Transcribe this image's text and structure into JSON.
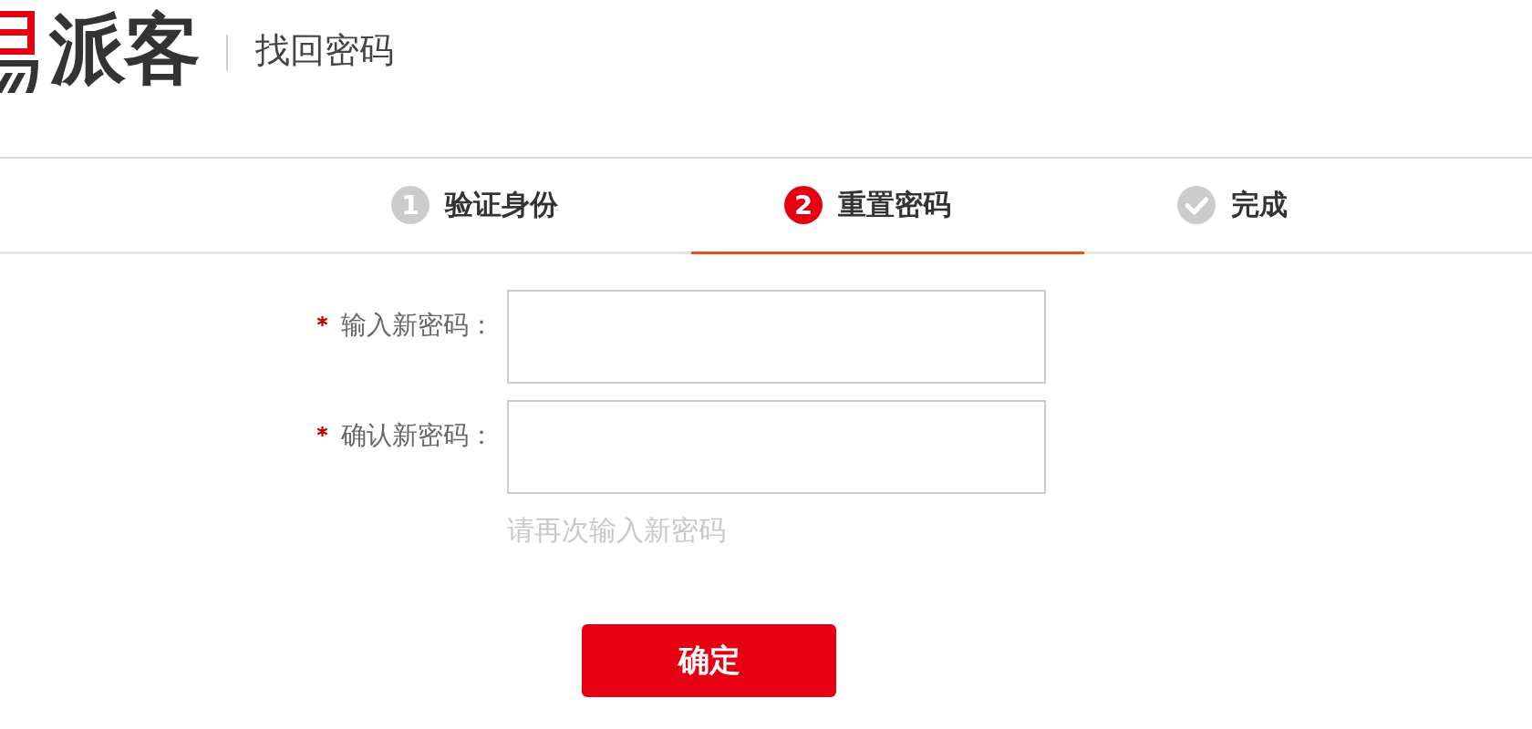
{
  "header": {
    "logo_text": "派客",
    "title": "找回密码"
  },
  "steps": [
    {
      "kind": "number",
      "number": "1",
      "label": "验证身份",
      "selected": false
    },
    {
      "kind": "number",
      "number": "2",
      "label": "重置密码",
      "selected": true
    },
    {
      "kind": "check",
      "label": "完成",
      "selected": false
    }
  ],
  "fields": [
    {
      "label": "输入新密码：",
      "required": true
    },
    {
      "label": "确认新密码：",
      "required": true,
      "hint": "请再次输入新密码"
    }
  ],
  "submit_button": {
    "label": "确定"
  }
}
